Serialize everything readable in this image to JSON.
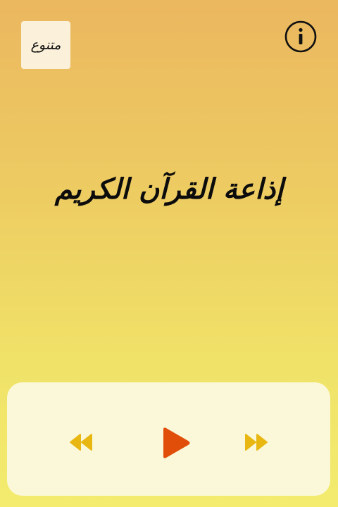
{
  "header": {
    "category_label": "متنوع"
  },
  "station": {
    "title": "إذاعة القرآن الكريم"
  },
  "player": {
    "state": "paused"
  },
  "icons": {
    "info": "info-circle-icon",
    "rewind": "rewind-icon",
    "play": "play-icon",
    "forward": "fast-forward-icon"
  },
  "colors": {
    "background_top": "#ebb75f",
    "background_bottom": "#f3ec6e",
    "panel": "#faf8d9",
    "play": "#e04e0a",
    "skip": "#e8b712",
    "category_bg": "#fbf0d9"
  }
}
